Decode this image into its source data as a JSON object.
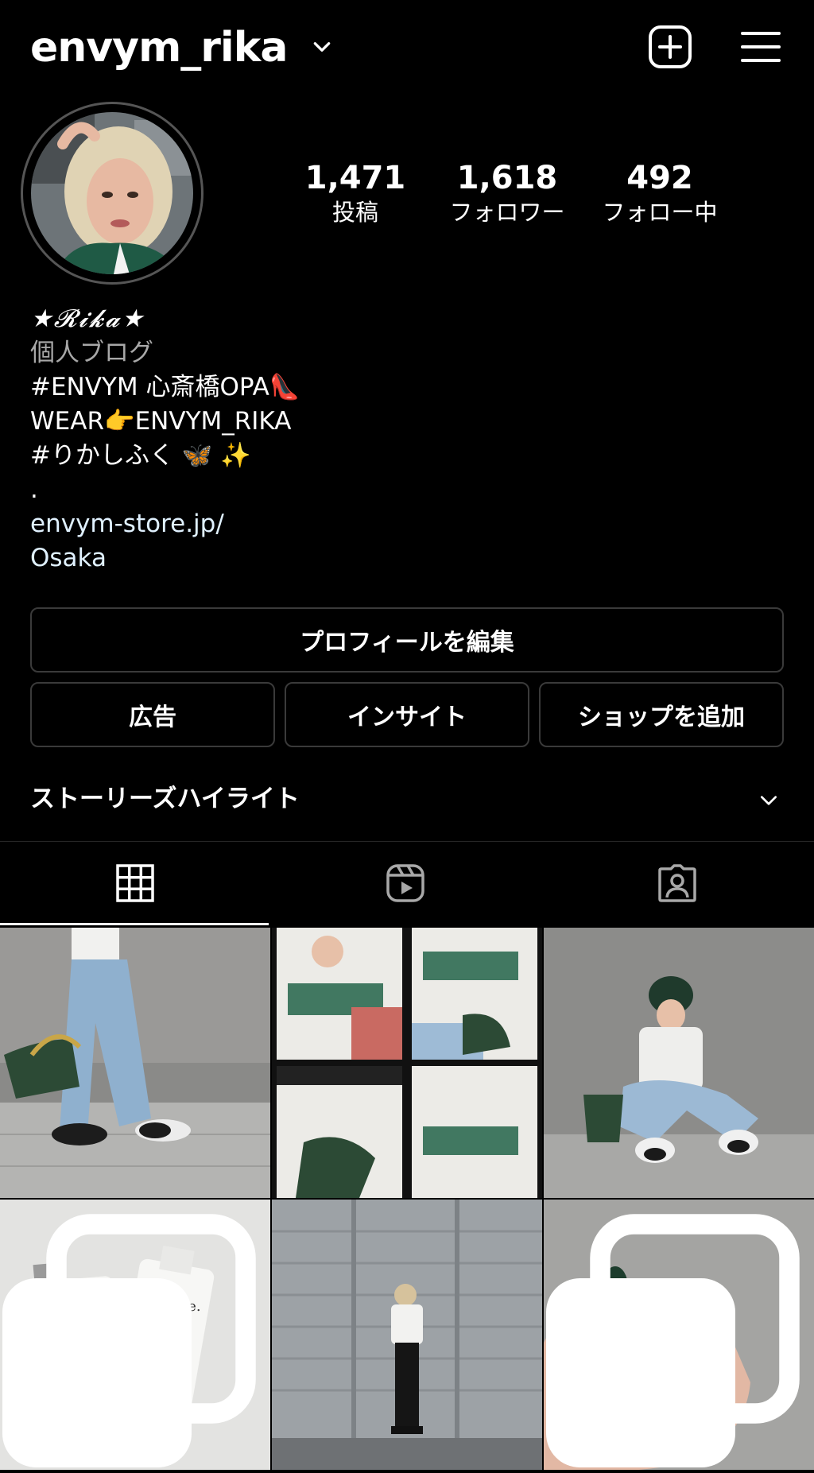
{
  "header": {
    "username": "envym_rika",
    "icons": {
      "dropdown": "chevron-down-icon",
      "add": "plus-square-icon",
      "menu": "hamburger-menu-icon"
    }
  },
  "stats": {
    "posts": {
      "value": "1,471",
      "label": "投稿"
    },
    "followers": {
      "value": "1,618",
      "label": "フォロワー"
    },
    "following": {
      "value": "492",
      "label": "フォロー中"
    }
  },
  "bio": {
    "name": "★𝓡𝓲𝓴𝓪★",
    "category": "個人ブログ",
    "lines": [
      "#ENVYM 心斎橋OPA👠",
      "WEAR👉ENVYM_RIKA",
      "#りかしふく 🦋 ✨",
      "."
    ],
    "link": "envym-store.jp/",
    "location": "Osaka"
  },
  "buttons": {
    "edit_profile": "プロフィールを編集",
    "ads": "広告",
    "insights": "インサイト",
    "add_shop": "ショップを追加"
  },
  "highlights": {
    "label": "ストーリーズハイライト"
  },
  "tabs": [
    {
      "name": "posts-grid",
      "icon": "grid-icon",
      "active": true
    },
    {
      "name": "reels",
      "icon": "reels-icon",
      "active": false
    },
    {
      "name": "tagged",
      "icon": "tagged-person-icon",
      "active": false
    }
  ],
  "posts": [
    {
      "subject": "denim-and-green-bag-street",
      "multi": false
    },
    {
      "subject": "white-tee-collage",
      "multi": false
    },
    {
      "subject": "sitting-cap-sneakers",
      "multi": false
    },
    {
      "subject": "dance-skincare-bottles",
      "multi": true
    },
    {
      "subject": "standing-shutter-wall",
      "multi": false
    },
    {
      "subject": "green-nails-hand",
      "multi": true
    }
  ],
  "colors": {
    "background": "#000000",
    "text": "#ffffff",
    "secondary_text": "#a8a8a8",
    "link": "#e0f1ff",
    "button_border": "#3a3a3a"
  }
}
